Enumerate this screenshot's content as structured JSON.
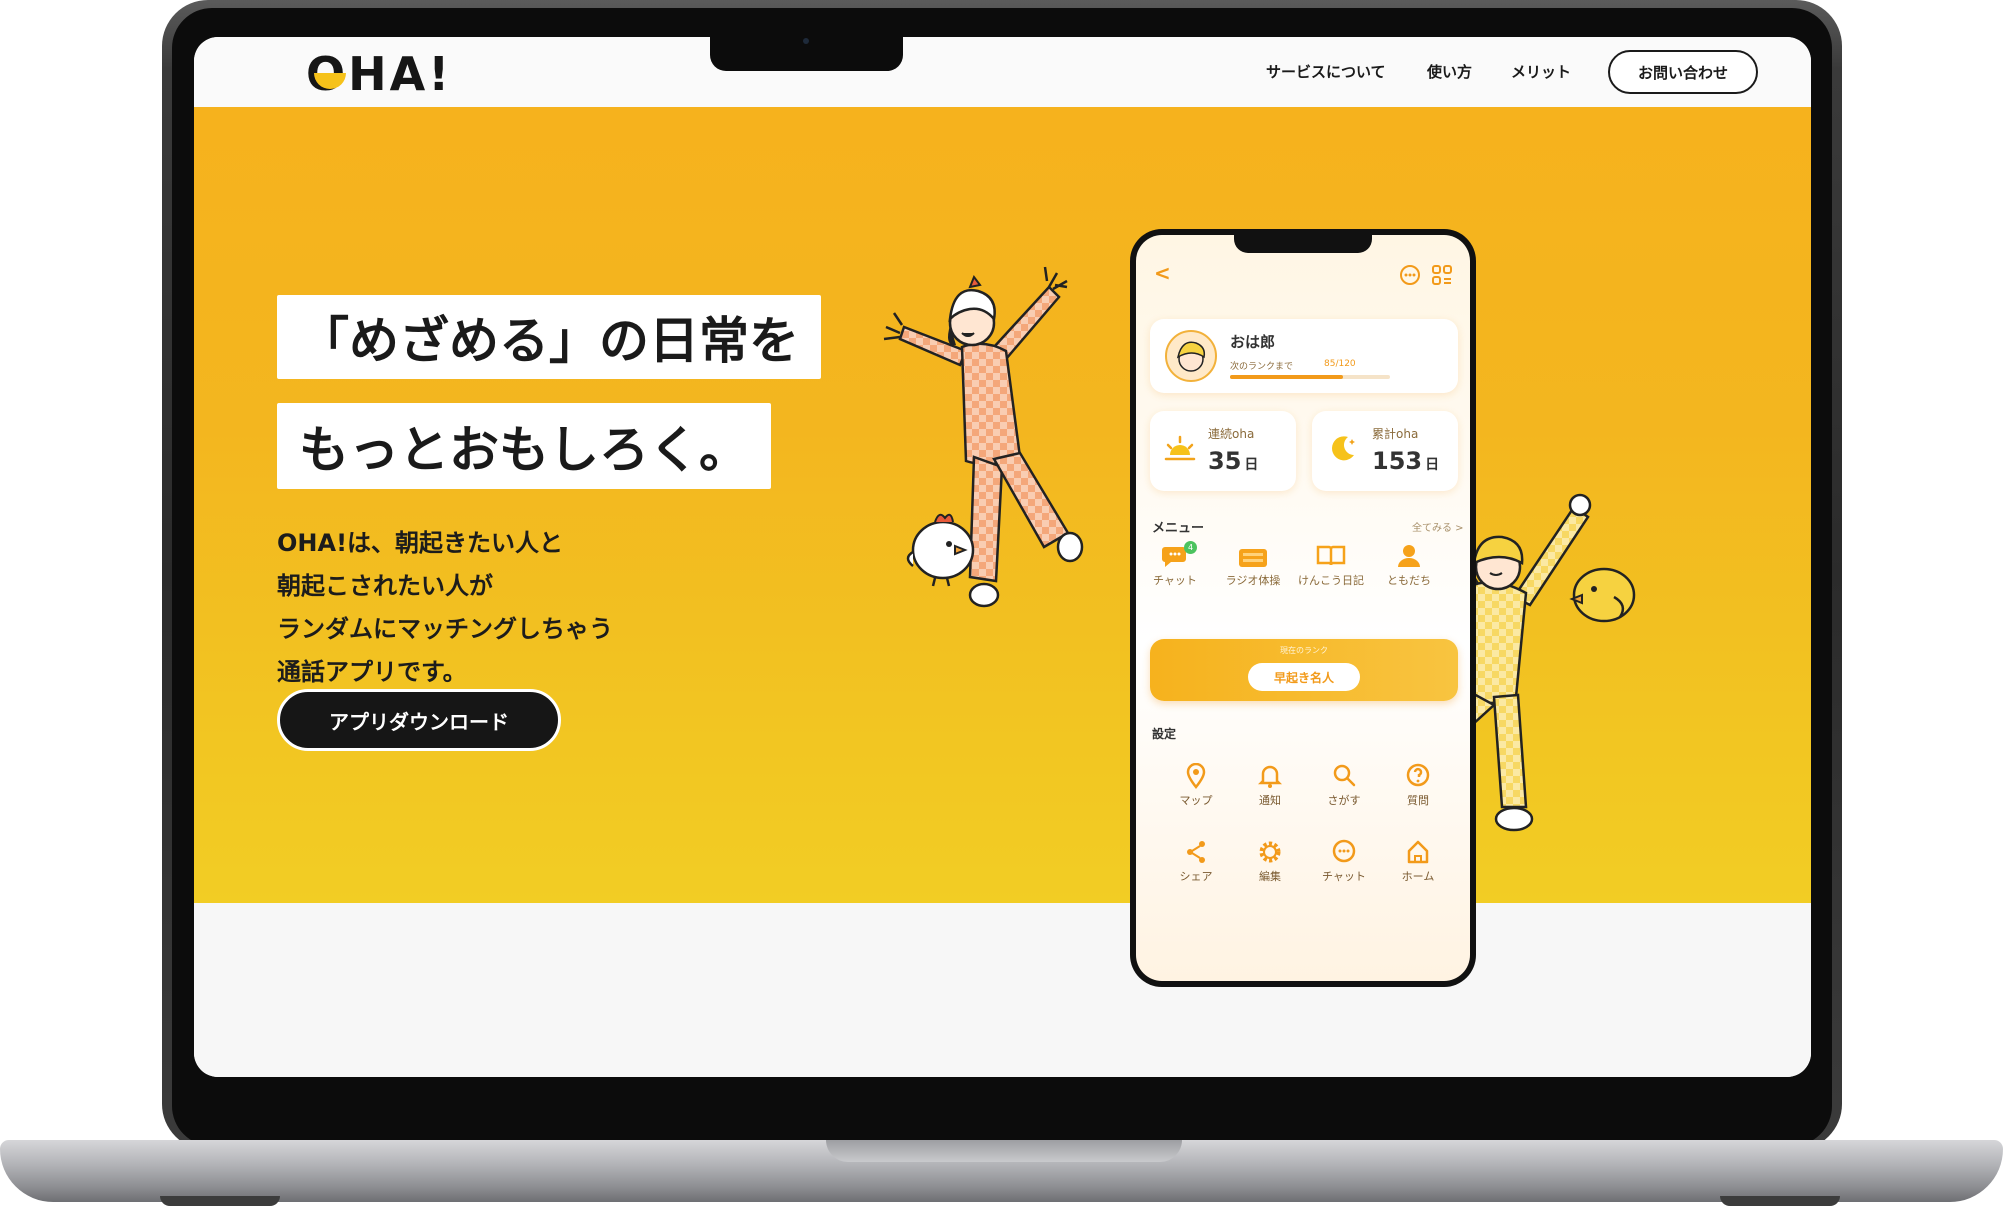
{
  "header": {
    "logo": "OHA!",
    "nav": [
      "サービスについて",
      "使い方",
      "メリット"
    ],
    "contact_label": "お問い合わせ"
  },
  "hero": {
    "headline_1": "「めざめる」の日常を",
    "headline_2": "もっとおもしろく。",
    "description": [
      "OHA!は、朝起きたい人と",
      "朝起こされたい人が",
      "ランダムにマッチングしちゃう",
      "通話アプリです。"
    ],
    "download_label": "アプリダウンロード"
  },
  "phone": {
    "back_glyph": "<",
    "profile_name": "おは郎",
    "next_rank_label": "次のランクまで",
    "rank_progress_text": "85/120",
    "rank_progress": 0.708,
    "streak_label": "連続oha",
    "streak_value": "35",
    "total_label": "累計oha",
    "total_value": "153",
    "day_unit": "日",
    "menu_title": "メニュー",
    "see_all": "全てみる >",
    "menu_items": [
      "チャット",
      "ラジオ体操",
      "けんこう日記",
      "ともだち"
    ],
    "chat_badge": "4",
    "current_rank_label": "現在のランク",
    "current_rank": "早起き名人",
    "settings_title": "設定",
    "settings_items": [
      "マップ",
      "通知",
      "さがす",
      "質問",
      "シェア",
      "編集",
      "チャット",
      "ホーム"
    ]
  },
  "colors": {
    "accent": "#f6b21d",
    "accent_orange": "#f29a1a",
    "dark": "#161616"
  }
}
